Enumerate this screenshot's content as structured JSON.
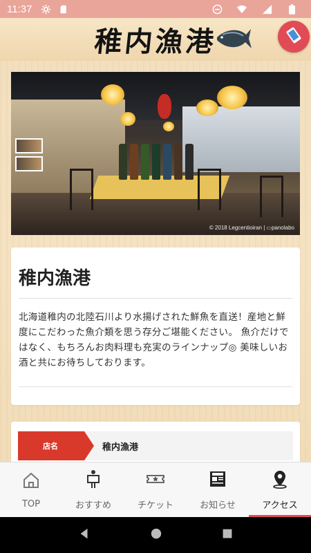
{
  "status_bar": {
    "time": "11:37"
  },
  "header": {
    "logo_text": "稚内漁港",
    "icons": [
      "fish-icon",
      "rotate-phone-icon"
    ]
  },
  "photo": {
    "credit": "© 2018 Legcentioiran | ▭panolabo"
  },
  "info": {
    "title": "稚内漁港",
    "description": "北海道稚内の北陸石川より水揚げされた鮮魚を直送！産地と鮮度にこだわった魚介類を思う存分ご堪能ください。 魚介だけではなく、もちろんお肉料理も充実のラインナップ◎ 美味しいお酒と共にお待ちしております。"
  },
  "shop_table": {
    "rows": [
      {
        "label": "店名",
        "value": "稚内漁港"
      }
    ]
  },
  "bottom_nav": {
    "items": [
      {
        "label": "TOP",
        "icon": "home-icon"
      },
      {
        "label": "おすすめ",
        "icon": "recommend-icon"
      },
      {
        "label": "チケット",
        "icon": "ticket-icon"
      },
      {
        "label": "お知らせ",
        "icon": "news-icon"
      },
      {
        "label": "アクセス",
        "icon": "map-pin-icon"
      }
    ],
    "active_index": 4
  },
  "colors": {
    "accent": "#e14b56",
    "label_red": "#d9392b",
    "status_bar": "#e9a59a"
  }
}
